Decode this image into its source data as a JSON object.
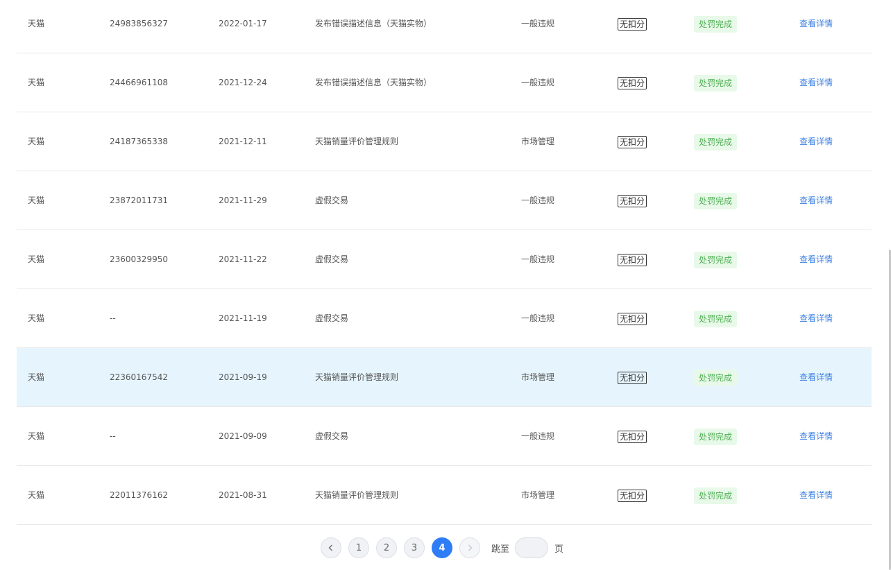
{
  "rows": [
    {
      "platform": "天猫",
      "order_id": "24983856327",
      "date": "2022-01-17",
      "rule": "发布错误描述信息（天猫实物）",
      "violation_type": "一般违规",
      "deduction": "无扣分",
      "status": "处罚完成",
      "action": "查看详情"
    },
    {
      "platform": "天猫",
      "order_id": "24466961108",
      "date": "2021-12-24",
      "rule": "发布错误描述信息（天猫实物）",
      "violation_type": "一般违规",
      "deduction": "无扣分",
      "status": "处罚完成",
      "action": "查看详情"
    },
    {
      "platform": "天猫",
      "order_id": "24187365338",
      "date": "2021-12-11",
      "rule": "天猫销量评价管理规则",
      "violation_type": "市场管理",
      "deduction": "无扣分",
      "status": "处罚完成",
      "action": "查看详情"
    },
    {
      "platform": "天猫",
      "order_id": "23872011731",
      "date": "2021-11-29",
      "rule": "虚假交易",
      "violation_type": "一般违规",
      "deduction": "无扣分",
      "status": "处罚完成",
      "action": "查看详情"
    },
    {
      "platform": "天猫",
      "order_id": "23600329950",
      "date": "2021-11-22",
      "rule": "虚假交易",
      "violation_type": "一般违规",
      "deduction": "无扣分",
      "status": "处罚完成",
      "action": "查看详情"
    },
    {
      "platform": "天猫",
      "order_id": "--",
      "date": "2021-11-19",
      "rule": "虚假交易",
      "violation_type": "一般违规",
      "deduction": "无扣分",
      "status": "处罚完成",
      "action": "查看详情"
    },
    {
      "platform": "天猫",
      "order_id": "22360167542",
      "date": "2021-09-19",
      "rule": "天猫销量评价管理规则",
      "violation_type": "市场管理",
      "deduction": "无扣分",
      "status": "处罚完成",
      "action": "查看详情"
    },
    {
      "platform": "天猫",
      "order_id": "--",
      "date": "2021-09-09",
      "rule": "虚假交易",
      "violation_type": "一般违规",
      "deduction": "无扣分",
      "status": "处罚完成",
      "action": "查看详情"
    },
    {
      "platform": "天猫",
      "order_id": "22011376162",
      "date": "2021-08-31",
      "rule": "天猫销量评价管理规则",
      "violation_type": "市场管理",
      "deduction": "无扣分",
      "status": "处罚完成",
      "action": "查看详情"
    }
  ],
  "highlighted_row": 6,
  "pagination": {
    "prev_icon": "chevron-left-icon",
    "next_icon": "chevron-right-icon",
    "pages": [
      "1",
      "2",
      "3",
      "4"
    ],
    "current_page": "4",
    "jump_label": "跳至",
    "jump_value": "",
    "page_suffix": "页"
  },
  "colors": {
    "link": "#3d7fe0",
    "status_text": "#4caf50",
    "status_bg": "#e8f9e9",
    "highlight_row": "#e6f5fd",
    "active_page": "#2f7df6"
  }
}
